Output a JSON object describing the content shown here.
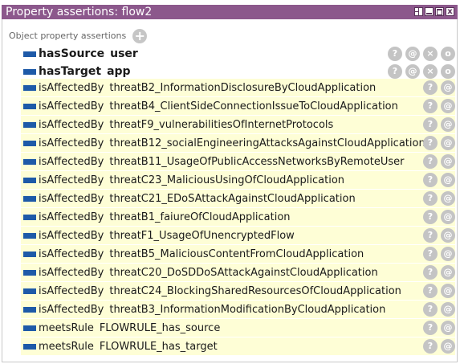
{
  "window": {
    "title": "Property assertions: flow2"
  },
  "section": {
    "label": "Object property assertions",
    "add_glyph": "+"
  },
  "action_glyphs": {
    "explain": "?",
    "annotate": "@",
    "delete": "×",
    "edit": "o"
  },
  "bold_assertions": [
    {
      "property": "hasSource",
      "value": "user"
    },
    {
      "property": "hasTarget",
      "value": "app"
    }
  ],
  "assertions": [
    {
      "property": "isAffectedBy",
      "value": "threatB2_InformationDisclosureByCloudApplication"
    },
    {
      "property": "isAffectedBy",
      "value": "threatB4_ClientSideConnectionIssueToCloudApplication"
    },
    {
      "property": "isAffectedBy",
      "value": "threatF9_vulnerabilitiesOfInternetProtocols"
    },
    {
      "property": "isAffectedBy",
      "value": "threatB12_socialEngineeringAttacksAgainstCloudApplication"
    },
    {
      "property": "isAffectedBy",
      "value": "threatB11_UsageOfPublicAccessNetworksByRemoteUser"
    },
    {
      "property": "isAffectedBy",
      "value": "threatC23_MaliciousUsingOfCloudApplication"
    },
    {
      "property": "isAffectedBy",
      "value": "threatC21_EDoSAttackAgainstCloudApplication"
    },
    {
      "property": "isAffectedBy",
      "value": "threatB1_faiureOfCloudApplication"
    },
    {
      "property": "isAffectedBy",
      "value": "threatF1_UsageOfUnencryptedFlow"
    },
    {
      "property": "isAffectedBy",
      "value": "threatB5_MaliciousContentFromCloudApplication"
    },
    {
      "property": "isAffectedBy",
      "value": "threatC20_DoSDDoSAttackAgainstCloudApplication"
    },
    {
      "property": "isAffectedBy",
      "value": "threatC24_BlockingSharedResourcesOfCloudApplication"
    },
    {
      "property": "isAffectedBy",
      "value": "threatB3_InformationModificationByCloudApplication"
    },
    {
      "property": "meetsRule",
      "value": "FLOWRULE_has_source"
    },
    {
      "property": "meetsRule",
      "value": "FLOWRULE_has_target"
    }
  ],
  "colors": {
    "titlebar": "#8c588c",
    "inferred_bg": "#fefed6",
    "property_swatch": "#1e5aa8"
  }
}
